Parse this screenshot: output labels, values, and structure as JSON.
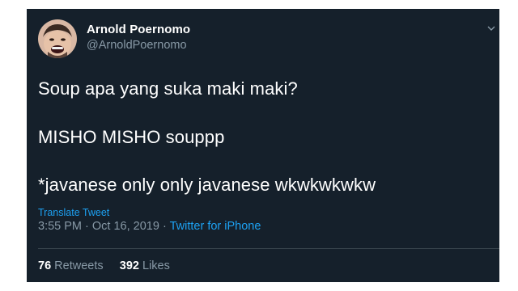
{
  "user": {
    "display_name": "Arnold Poernomo",
    "handle": "@ArnoldPoernomo",
    "avatar_icon": "profile-photo"
  },
  "tweet": {
    "lines": [
      "Soup apa yang suka maki maki?",
      "MISHO MISHO souppp",
      "*javanese only only javanese wkwkwkwkw"
    ],
    "translate_label": "Translate Tweet",
    "time": "3:55 PM",
    "separator": "·",
    "date": "Oct 16, 2019",
    "source": "Twitter for iPhone"
  },
  "stats": {
    "retweets_count": "76",
    "retweets_label": "Retweets",
    "likes_count": "392",
    "likes_label": "Likes"
  },
  "colors": {
    "background": "#15202b",
    "text": "#ffffff",
    "muted": "#8899a6",
    "accent": "#1da1f2"
  }
}
